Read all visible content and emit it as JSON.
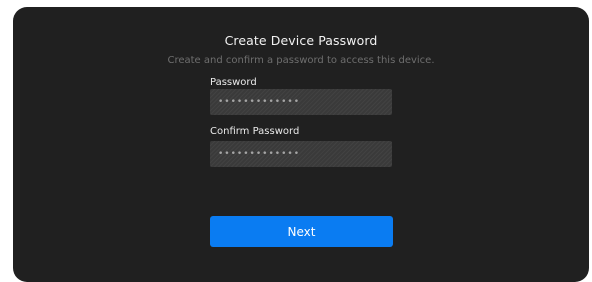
{
  "dialog": {
    "title": "Create Device Password",
    "subtitle": "Create and confirm a password to access this device."
  },
  "password": {
    "label": "Password",
    "placeholder": "•••••••••••••"
  },
  "confirm_password": {
    "label": "Confirm Password",
    "placeholder": "•••••••••••••"
  },
  "next_button": {
    "label": "Next"
  },
  "colors": {
    "background": "#202020",
    "accent": "#0a7cf2",
    "input_background": "#3a3a3a"
  }
}
